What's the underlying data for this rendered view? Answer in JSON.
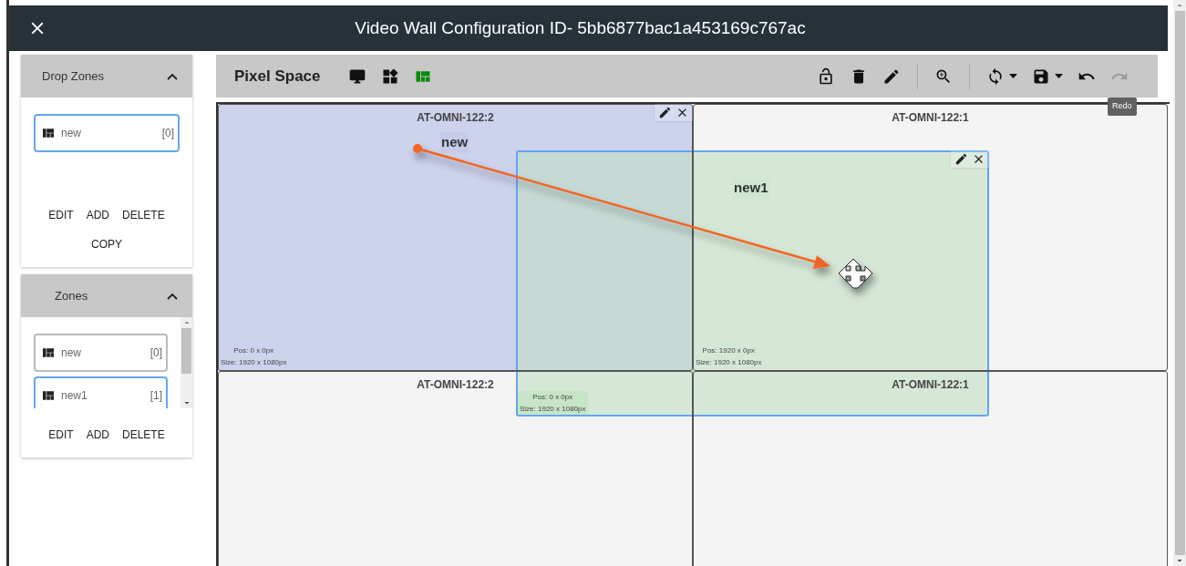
{
  "header": {
    "title": "Video Wall Configuration ID- 5bb6877bac1a453169c767ac"
  },
  "panels": [
    {
      "title": "Drop Zones",
      "expanded": true,
      "scroll": false,
      "items": [
        {
          "name": "new",
          "index": "[0]",
          "selected": true
        }
      ],
      "actions": [
        "EDIT",
        "ADD",
        "DELETE",
        "COPY"
      ]
    },
    {
      "title": "Zones",
      "expanded": true,
      "scroll": true,
      "items": [
        {
          "name": "new",
          "index": "[0]",
          "selected": false
        },
        {
          "name": "new1",
          "index": "[1]",
          "selected": true
        }
      ],
      "actions": [
        "EDIT",
        "ADD",
        "DELETE"
      ]
    }
  ],
  "toolbar": {
    "title": "Pixel Space",
    "view_modes": [
      {
        "kind": "monitor",
        "selected": false
      },
      {
        "kind": "widgets",
        "selected": false
      },
      {
        "kind": "layout",
        "selected": true
      }
    ],
    "tools": [
      {
        "kind": "lock",
        "disabled": false
      },
      {
        "kind": "delete",
        "disabled": false
      },
      {
        "kind": "edit",
        "disabled": false
      },
      {
        "kind": "zoom",
        "disabled": false
      },
      {
        "kind": "sync",
        "disabled": false
      },
      {
        "kind": "save",
        "disabled": false
      },
      {
        "kind": "undo",
        "disabled": false
      },
      {
        "kind": "redo",
        "disabled": true
      }
    ],
    "tooltip": "Redo"
  },
  "canvas": {
    "screens": [
      {
        "label": "AT-OMNI-122:2",
        "pos": "Pos: 0 x 0px",
        "size": "Size: 1920 x 1080px"
      },
      {
        "label": "AT-OMNI-122:1",
        "pos": "Pos: 1920 x 0px",
        "size": "Size: 1920 x 1080px"
      },
      {
        "label": "AT-OMNI-122:2"
      },
      {
        "label": "AT-OMNI-122:1"
      }
    ],
    "zones": [
      {
        "kind": "origin",
        "name": "new"
      },
      {
        "kind": "moving",
        "name": "new1",
        "pos": "Pos: 0 x 0px",
        "size": "Size: 1920 x 1080px"
      }
    ]
  }
}
